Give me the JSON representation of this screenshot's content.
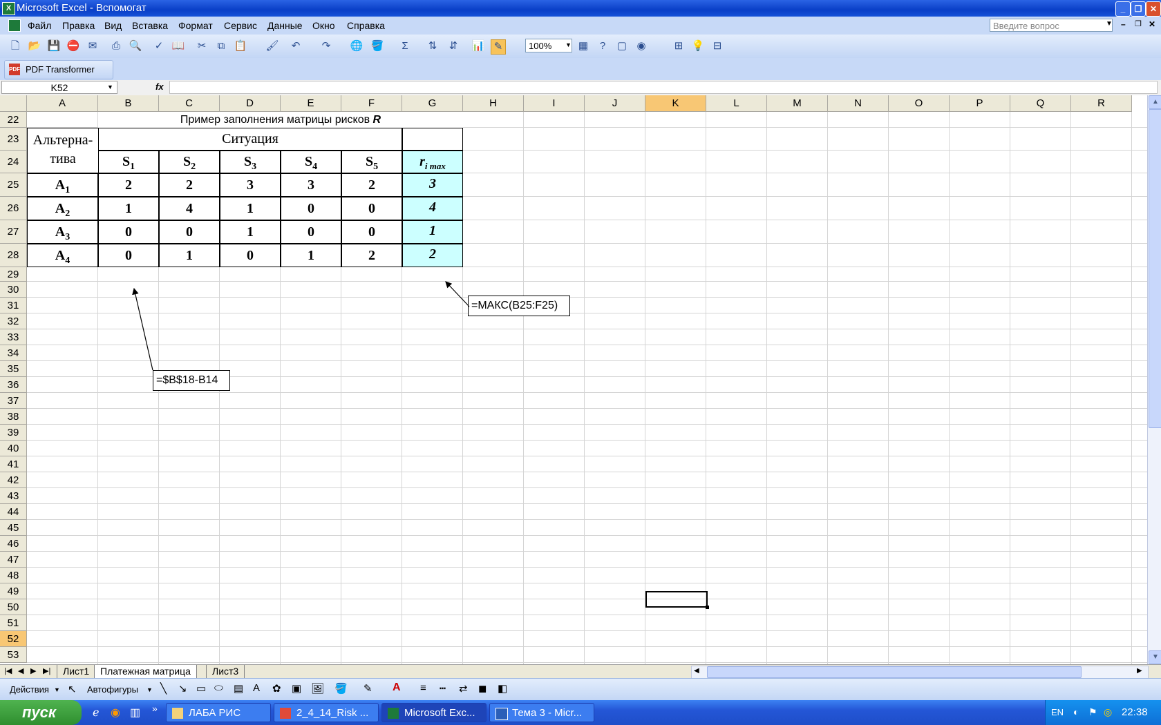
{
  "window": {
    "title": "Microsoft Excel - Вспомогат"
  },
  "menu": [
    "Файл",
    "Правка",
    "Вид",
    "Вставка",
    "Формат",
    "Сервис",
    "Данные",
    "Окно",
    "Справка"
  ],
  "help_box_placeholder": "Введите вопрос",
  "toolbar": {
    "zoom": "100%",
    "pdf_label": "PDF Transformer"
  },
  "formula_bar": {
    "name_box": "K52",
    "fx": "fx",
    "formula": ""
  },
  "columns": [
    "A",
    "B",
    "C",
    "D",
    "E",
    "F",
    "G",
    "H",
    "I",
    "J",
    "K",
    "L",
    "M",
    "N",
    "O",
    "P",
    "Q",
    "R"
  ],
  "selected_column": "K",
  "rows": [
    "22",
    "23",
    "24",
    "25",
    "26",
    "27",
    "28",
    "29",
    "30",
    "31",
    "32",
    "33",
    "34",
    "35",
    "36",
    "37",
    "38",
    "39",
    "40",
    "41",
    "42",
    "43",
    "44",
    "45",
    "46",
    "47",
    "48",
    "49",
    "50",
    "51",
    "52",
    "53"
  ],
  "selected_row": "52",
  "table": {
    "title": "Пример заполнения матрицы рисков ",
    "title_var": "R",
    "alt_header": "Альтерна-тива",
    "situation_header": "Ситуация",
    "s_prefix": "S",
    "s_subs": [
      "1",
      "2",
      "3",
      "4",
      "5"
    ],
    "rmax_r": "r",
    "rmax_sub": "i  max",
    "a_prefix": "A",
    "a_subs": [
      "1",
      "2",
      "3",
      "4"
    ],
    "values": [
      [
        "2",
        "2",
        "3",
        "3",
        "2"
      ],
      [
        "1",
        "4",
        "1",
        "0",
        "0"
      ],
      [
        "0",
        "0",
        "1",
        "0",
        "0"
      ],
      [
        "0",
        "1",
        "0",
        "1",
        "2"
      ]
    ],
    "rmax": [
      "3",
      "4",
      "1",
      "2"
    ]
  },
  "notes": {
    "max_formula": "=МАКС(B25:F25)",
    "diff_formula": "=$B$18-B14"
  },
  "sheets": [
    "Лист1",
    "Платежная матрица",
    "Лист3"
  ],
  "active_sheet": "Платежная матрица",
  "draw_toolbar": {
    "actions": "Действия",
    "autoshapes": "Автофигуры"
  },
  "taskbar": {
    "start": "пуск",
    "tasks": [
      "ЛАБА РИС",
      "2_4_14_Risk ...",
      "Microsoft Exc...",
      "Тема 3 - Micr..."
    ],
    "active_task": "Microsoft Exc...",
    "lang": "EN",
    "clock": "22:38"
  },
  "colors": {
    "cyan_cell": "#ccffff",
    "selected_header": "#f8c774",
    "taskbar": "#2456d6",
    "start": "#3a9d3a"
  }
}
